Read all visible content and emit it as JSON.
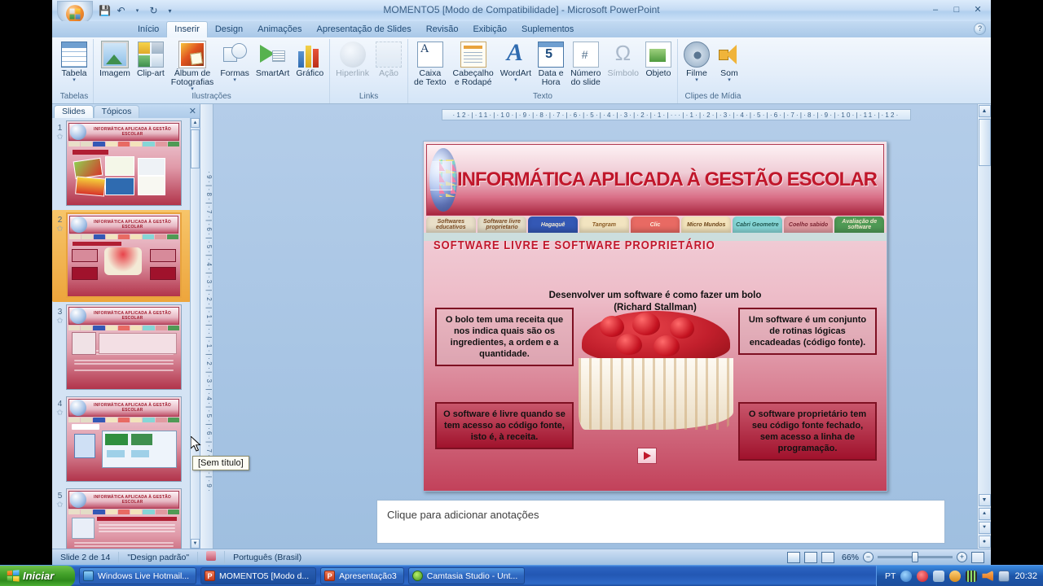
{
  "window": {
    "title": "MOMENTO5 [Modo de Compatibilidade] - Microsoft PowerPoint",
    "minimize": "–",
    "restore": "□",
    "close": "✕",
    "qat": {
      "save": "💾",
      "undo": "↶",
      "redo": "↻",
      "more": "▾"
    },
    "help": "?"
  },
  "ribbon": {
    "tabs": [
      {
        "label": "Início",
        "active": false
      },
      {
        "label": "Inserir",
        "active": true
      },
      {
        "label": "Design",
        "active": false
      },
      {
        "label": "Animações",
        "active": false
      },
      {
        "label": "Apresentação de Slides",
        "active": false
      },
      {
        "label": "Revisão",
        "active": false
      },
      {
        "label": "Exibição",
        "active": false
      },
      {
        "label": "Suplementos",
        "active": false
      }
    ],
    "groups": [
      {
        "label": "Tabelas",
        "items": [
          {
            "label": "Tabela",
            "icon": "table-icon",
            "caret": true,
            "disabled": false
          }
        ]
      },
      {
        "label": "Ilustrações",
        "items": [
          {
            "label": "Imagem",
            "icon": "picture-icon",
            "caret": false,
            "disabled": false
          },
          {
            "label": "Clip-art",
            "icon": "clipart-icon",
            "caret": false,
            "disabled": false
          },
          {
            "label": "Álbum de\nFotografias",
            "icon": "photo-album-icon",
            "caret": true,
            "disabled": false
          },
          {
            "label": "Formas",
            "icon": "shapes-icon",
            "caret": true,
            "disabled": false
          },
          {
            "label": "SmartArt",
            "icon": "smartart-icon",
            "caret": false,
            "disabled": false
          },
          {
            "label": "Gráfico",
            "icon": "chart-icon",
            "caret": false,
            "disabled": false
          }
        ]
      },
      {
        "label": "Links",
        "items": [
          {
            "label": "Hiperlink",
            "icon": "hyperlink-icon",
            "caret": false,
            "disabled": true
          },
          {
            "label": "Ação",
            "icon": "action-icon",
            "caret": false,
            "disabled": true
          }
        ]
      },
      {
        "label": "Texto",
        "items": [
          {
            "label": "Caixa\nde Texto",
            "icon": "text-box-icon",
            "caret": false,
            "disabled": false
          },
          {
            "label": "Cabeçalho\ne Rodapé",
            "icon": "header-footer-icon",
            "caret": false,
            "disabled": false
          },
          {
            "label": "WordArt",
            "icon": "wordart-icon",
            "caret": true,
            "disabled": false
          },
          {
            "label": "Data e\nHora",
            "icon": "date-time-icon",
            "caret": false,
            "disabled": false
          },
          {
            "label": "Número\ndo slide",
            "icon": "slide-number-icon",
            "caret": false,
            "disabled": false
          },
          {
            "label": "Símbolo",
            "icon": "symbol-icon",
            "caret": false,
            "disabled": true
          },
          {
            "label": "Objeto",
            "icon": "object-icon",
            "caret": false,
            "disabled": false
          }
        ]
      },
      {
        "label": "Clipes de Mídia",
        "items": [
          {
            "label": "Filme",
            "icon": "movie-icon",
            "caret": true,
            "disabled": false
          },
          {
            "label": "Som",
            "icon": "sound-icon",
            "caret": true,
            "disabled": false
          }
        ]
      }
    ]
  },
  "left_panel": {
    "tabs": [
      {
        "label": "Slides",
        "active": true
      },
      {
        "label": "Tópicos",
        "active": false
      }
    ],
    "close": "✕",
    "thumbnails": [
      {
        "number": "1",
        "selected": false,
        "kind": "cards"
      },
      {
        "number": "2",
        "selected": true,
        "kind": "cake"
      },
      {
        "number": "3",
        "selected": false,
        "kind": "text"
      },
      {
        "number": "4",
        "selected": false,
        "kind": "hagaque"
      },
      {
        "number": "5",
        "selected": false,
        "kind": "text2"
      }
    ],
    "tooltip": "[Sem título]"
  },
  "rulers": {
    "horizontal": "·12·|·11·|·10·|·9·|·8·|·7·|·6·|·5·|·4·|·3·|·2·|·1·|···|·1·|·2·|·3·|·4·|·5·|·6·|·7·|·8·|·9·|·10·|·11·|·12·",
    "vertical": "·9·|·8·|·7·|·6·|·5·|·4·|·3·|·2·|·1·|··|·1·|·2·|·3·|·4·|·5·|·6·|·7·|·8·|·9·"
  },
  "slide": {
    "banner_title": "INFORMÁTICA APLICADA À GESTÃO ESCOLAR",
    "nav_tabs": [
      {
        "label": "Softwares educativos",
        "color": "#e9dfc8",
        "text_color": "#7a4a22"
      },
      {
        "label": "Software livre proprietario",
        "color": "#e3dcc6",
        "text_color": "#7a4a22"
      },
      {
        "label": "Hagaquê",
        "color": "#3458b5",
        "text_color": "#f3e9d0"
      },
      {
        "label": "Tangram",
        "color": "#f2e4c0",
        "text_color": "#8a5a22"
      },
      {
        "label": "Clic",
        "color": "#e86a63",
        "text_color": "#fdf0e0"
      },
      {
        "label": "Micro Mundos",
        "color": "#f3e3bb",
        "text_color": "#6c4418"
      },
      {
        "label": "Cabri Geometre",
        "color": "#86d6d6",
        "text_color": "#20564f"
      },
      {
        "label": "Coelho sabido",
        "color": "#e19aa0",
        "text_color": "#7a2230"
      },
      {
        "label": "Avaliação de software",
        "color": "#4f9a55",
        "text_color": "#f0e8cd"
      }
    ],
    "section_title": "SOFTWARE  LIVRE  E  SOFTWARE  PROPRIETÁRIO",
    "lead_line1": "Desenvolver um software é como fazer um bolo",
    "lead_line2": "(Richard Stallman)",
    "boxes": [
      {
        "id": "top-left",
        "style": "light",
        "text": "O bolo tem uma receita que nos indica quais são os ingredientes, a ordem e a quantidade."
      },
      {
        "id": "top-right",
        "style": "light",
        "text": "Um software é um conjunto de rotinas lógicas encadeadas (código fonte)."
      },
      {
        "id": "bottom-left",
        "style": "dark",
        "text": "O software é livre quando se tem acesso ao código fonte, isto é, à receita."
      },
      {
        "id": "bottom-right",
        "style": "dark",
        "text": "O software proprietário tem seu código fonte fechado, sem acesso a linha de programação."
      }
    ],
    "play_button": "play-icon"
  },
  "notes": {
    "placeholder": "Clique para adicionar anotações"
  },
  "status_bar": {
    "slide_info": "Slide 2 de 14",
    "theme": "\"Design padrão\"",
    "spell_icon": "spelling-icon",
    "language": "Português (Brasil)",
    "views": [
      {
        "name": "normal-view",
        "active": true
      },
      {
        "name": "slide-sorter-view",
        "active": false
      },
      {
        "name": "slide-show-view",
        "active": false
      }
    ],
    "zoom": "66%",
    "zoom_out": "−",
    "zoom_in": "+",
    "fit_to_window": "fit-icon"
  },
  "taskbar": {
    "start": "Iniciar",
    "items": [
      {
        "label": "Windows Live Hotmail...",
        "icon": "mail-icon",
        "active": false
      },
      {
        "label": "MOMENTO5 [Modo d...",
        "icon": "powerpoint-icon",
        "active": true
      },
      {
        "label": "Apresentação3",
        "icon": "powerpoint-icon",
        "active": false
      },
      {
        "label": "Camtasia Studio - Unt...",
        "icon": "camtasia-icon",
        "active": false
      }
    ],
    "tray_language": "PT",
    "clock": "20:32"
  },
  "colors": {
    "accent": "#c0172b",
    "slide_bg": "#edbcc8",
    "taskbar": "#2357b4",
    "start_green": "#43a12a"
  }
}
